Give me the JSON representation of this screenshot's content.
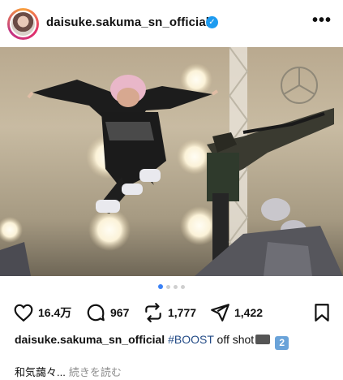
{
  "header": {
    "username": "daisuke.sakuma_sn_official",
    "verified_icon": "verified-badge-icon",
    "more_label": "•••"
  },
  "post": {
    "image_description_icon": "photo",
    "carousel": {
      "total": 4,
      "active": 1
    }
  },
  "actions": {
    "like_count": "16.4万",
    "comment_count": "967",
    "repost_count": "1,777",
    "share_count": "1,422"
  },
  "caption": {
    "user": "daisuke.sakuma_sn_official",
    "hashtag": "#BOOST",
    "text": " off shot",
    "emoji_two": "2"
  },
  "more": {
    "preview": "和気藹々...",
    "read_more": "続きを読む"
  },
  "colors": {
    "accent": "#1d9bf0",
    "hashtag": "#234b86",
    "dot_active": "#3b82f6"
  }
}
